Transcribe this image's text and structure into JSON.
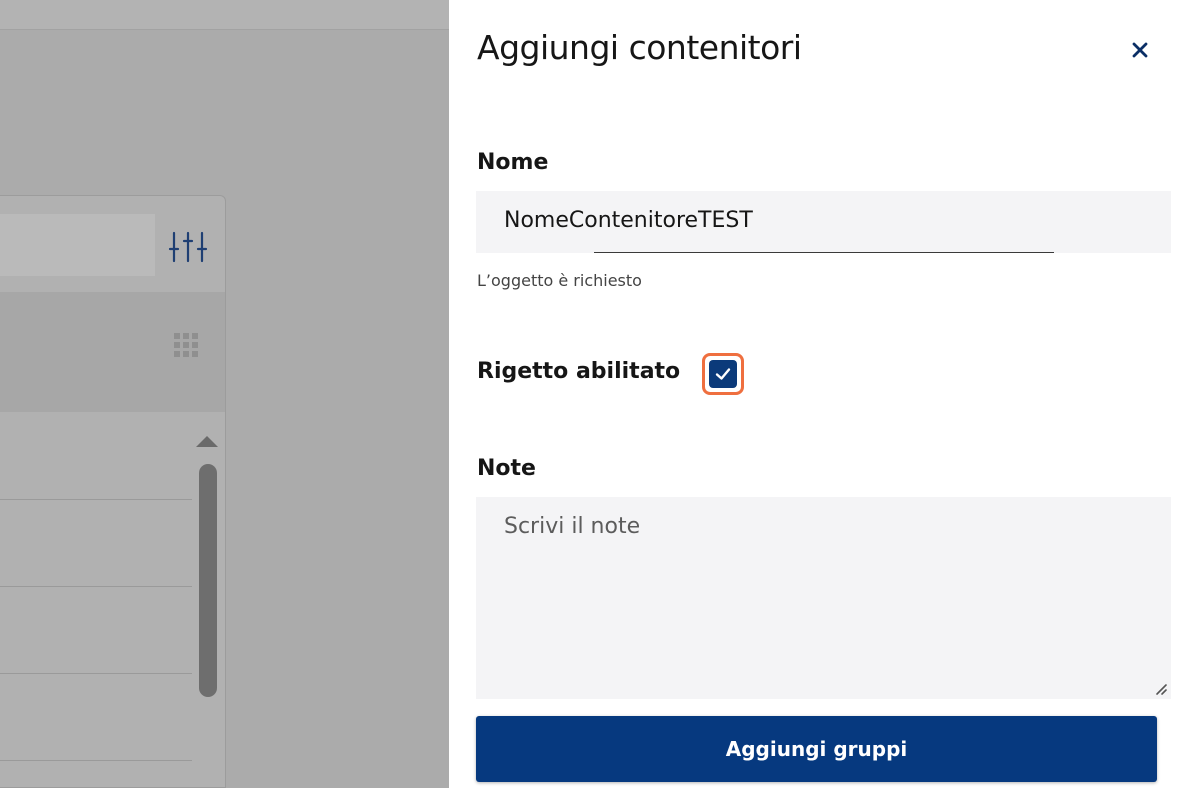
{
  "panel": {
    "title": "Aggiungi contenitori",
    "close_icon": "close-icon",
    "fields": {
      "nome": {
        "label": "Nome",
        "value": "NomeContenitoreTEST",
        "helper": "L’oggetto è richiesto"
      },
      "rigetto": {
        "label": "Rigetto abilitato",
        "checked": true
      },
      "note": {
        "label": "Note",
        "placeholder": "Scrivi il note",
        "value": ""
      }
    },
    "primary_button": "Aggiungi gruppi"
  },
  "background": {
    "icons": [
      "filter-sliders-icon",
      "grid-icon",
      "scroll-up-icon"
    ]
  },
  "colors": {
    "primary": "#06397f",
    "checkbox": "#0b3a7a",
    "focus_ring": "#ef6f3f",
    "field_bg": "#f4f4f6",
    "overlay": "#ababab"
  }
}
